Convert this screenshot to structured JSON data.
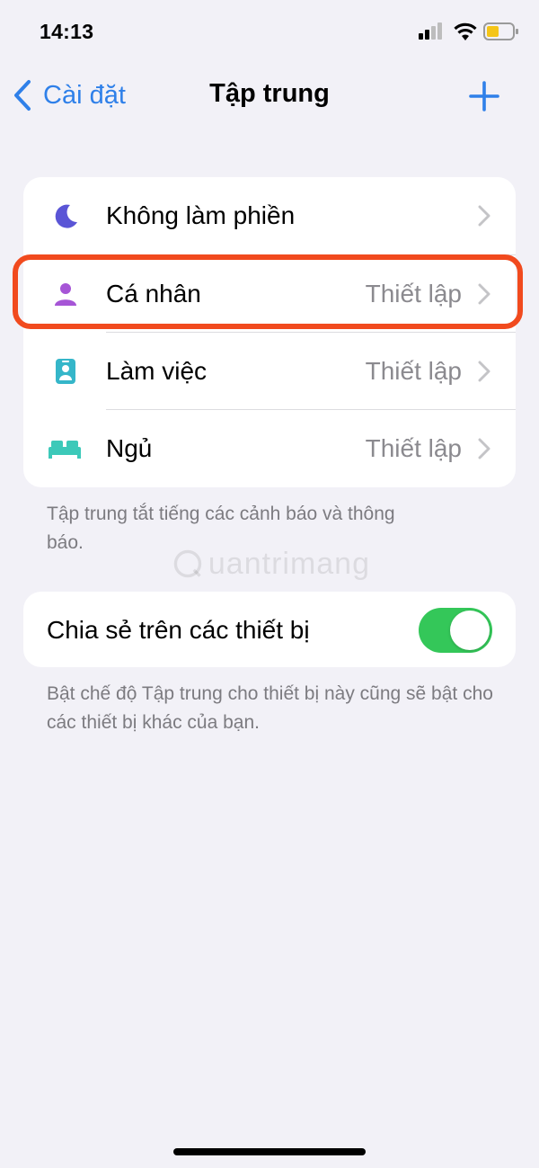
{
  "status_bar": {
    "time": "14:13",
    "battery_color": "#f5c518"
  },
  "nav": {
    "back_label": "Cài đặt",
    "title": "Tập trung",
    "add_icon": "plus-icon"
  },
  "focus_modes": [
    {
      "label": "Không làm phiền",
      "value": "",
      "icon": "moon-icon",
      "icon_color": "#5a55d6"
    },
    {
      "label": "Cá nhân",
      "value": "Thiết lập",
      "icon": "person-icon",
      "icon_color": "#a655d6",
      "highlighted": true
    },
    {
      "label": "Làm việc",
      "value": "Thiết lập",
      "icon": "id-badge-icon",
      "icon_color": "#35b6c9"
    },
    {
      "label": "Ngủ",
      "value": "Thiết lập",
      "icon": "bed-icon",
      "icon_color": "#3cc9b9"
    }
  ],
  "focus_footnote": "Tập trung tắt tiếng các cảnh báo và thông báo.",
  "share": {
    "label": "Chia sẻ trên các thiết bị",
    "enabled": true
  },
  "share_footnote": "Bật chế độ Tập trung cho thiết bị này cũng sẽ bật cho các thiết bị khác của bạn.",
  "watermark": "uantrimang",
  "colors": {
    "accent": "#2f80e9",
    "highlight": "#f14a1e",
    "toggle_on": "#34c759"
  }
}
